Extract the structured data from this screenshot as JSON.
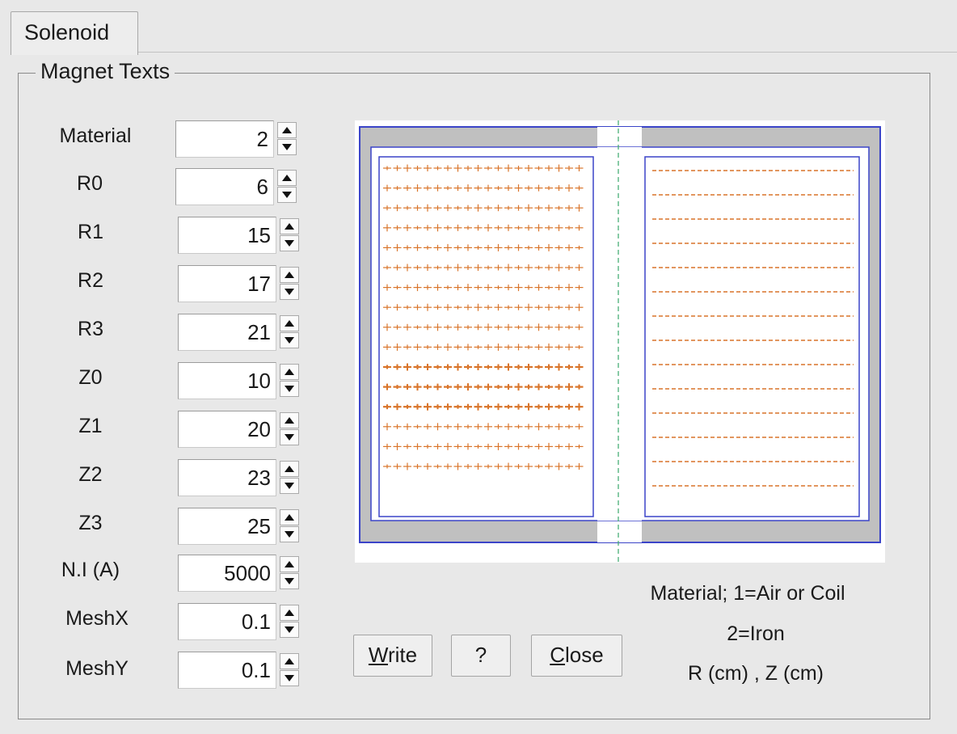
{
  "tab": {
    "label": "Solenoid"
  },
  "group": {
    "title": "Magnet Texts"
  },
  "fields": [
    {
      "label": "Material",
      "value": "2"
    },
    {
      "label": "R0",
      "value": "6"
    },
    {
      "label": "R1",
      "value": "15"
    },
    {
      "label": "R2",
      "value": "17"
    },
    {
      "label": "R3",
      "value": "21"
    },
    {
      "label": "Z0",
      "value": "10"
    },
    {
      "label": "Z1",
      "value": "20"
    },
    {
      "label": "Z2",
      "value": "23"
    },
    {
      "label": "Z3",
      "value": "25"
    },
    {
      "label": "N.I (A)",
      "value": "5000"
    },
    {
      "label": "MeshX",
      "value": "0.1"
    },
    {
      "label": "MeshY",
      "value": "0.1"
    }
  ],
  "buttons": {
    "write_mnemonic": "W",
    "write_rest": "rite",
    "help": "?",
    "close_mnemonic": "C",
    "close_rest": "lose"
  },
  "info": {
    "line1": "Material; 1=Air or Coil",
    "line2": "2=Iron",
    "line3": "R (cm) , Z (cm)"
  },
  "preview": {
    "colors": {
      "iron": "#c0c0c0",
      "outline": "#3b44c8",
      "field_marks": "#d9742a",
      "axis": "#3aa86b"
    }
  }
}
